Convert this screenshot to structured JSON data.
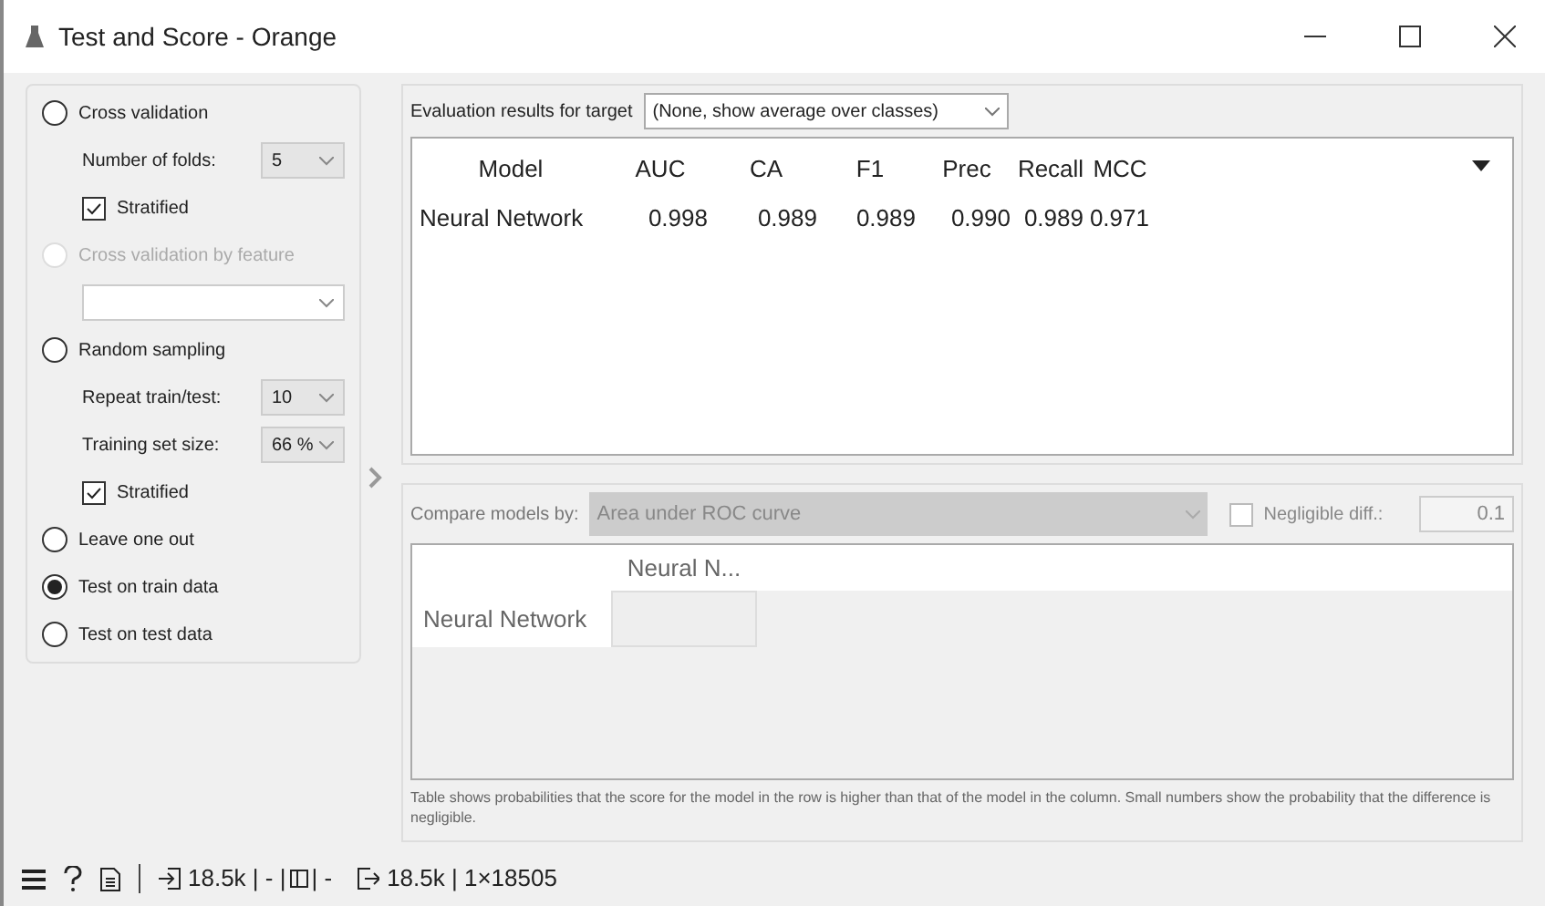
{
  "window": {
    "title": "Test and Score - Orange"
  },
  "sampling": [
    {
      "kind": "radio",
      "label": "Cross validation",
      "selected": false,
      "disabled": false
    },
    {
      "kind": "dropdown",
      "label": "Number of folds:",
      "value": "5"
    },
    {
      "kind": "checkbox",
      "label": "Stratified",
      "checked": true
    },
    {
      "kind": "radio",
      "label": "Cross validation by feature",
      "selected": false,
      "disabled": true
    },
    {
      "kind": "dropdown"
    },
    {
      "kind": "radio",
      "label": "Random sampling",
      "selected": false,
      "disabled": false
    },
    {
      "kind": "dropdown",
      "label": "Repeat train/test:",
      "value": "10"
    },
    {
      "kind": "dropdown",
      "label": "Training set size:",
      "value": "66 %"
    },
    {
      "kind": "checkbox",
      "label": "Stratified",
      "checked": true
    },
    {
      "kind": "radio",
      "label": "Leave one out",
      "selected": false,
      "disabled": false
    },
    {
      "kind": "radio",
      "label": "Test on train data",
      "selected": true,
      "disabled": false
    },
    {
      "kind": "radio",
      "label": "Test on test data",
      "selected": false,
      "disabled": false
    }
  ],
  "evaluation": {
    "target_label": "Evaluation results for target",
    "target_value": "(None, show average over classes)",
    "columns": [
      "Model",
      "AUC",
      "CA",
      "F1",
      "Prec",
      "Recall",
      "MCC"
    ],
    "rows": [
      [
        "Neural Network",
        "0.998",
        "0.989",
        "0.989",
        "0.990",
        "0.989",
        "0.971"
      ]
    ]
  },
  "comparison": {
    "label": "Compare models by:",
    "value": "Area under ROC curve",
    "negligible_label": "Negligible diff.:",
    "negligible_checked": false,
    "negligible_value": "0.1",
    "column_headers": [
      "Neural N..."
    ],
    "row_headers": [
      "Neural Network"
    ],
    "note": "Table shows probabilities that the score for the model in the row is higher than that of the model in the column. Small numbers show the probability that the difference is negligible."
  },
  "status_bar": {
    "input": "18.5k | - |",
    "middle": "| -",
    "output": "18.5k | 1×18505"
  }
}
